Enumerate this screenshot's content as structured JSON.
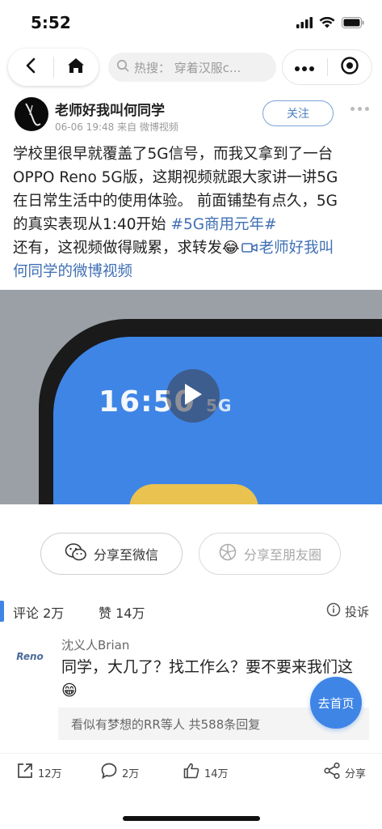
{
  "status_bar": {
    "time": "5:52",
    "icons": [
      "cellular-signal-icon",
      "wifi-icon",
      "battery-icon"
    ]
  },
  "nav": {
    "back_icon": "back-arrow-icon",
    "home_icon": "home-icon",
    "search_icon": "search-icon",
    "search_placeholder": "热搜：  穿着汉服c...",
    "more_icon": "more-dots-icon",
    "close_icon": "target-circle-icon"
  },
  "post": {
    "author": "老师好我叫何同学",
    "meta": "06-06 19:48 来自 微博视频",
    "follow_label": "关注",
    "text_lines": [
      "学校里很早就覆盖了5G信号，而我又拿到了一台",
      "OPPO Reno 5G版，这期视频就跟大家讲一讲5G",
      "在日常生活中的使用体验。 前面铺垫有点久，5G"
    ],
    "text_line4_prefix": "的真实表现从1:40开始 ",
    "hashtag": "#5G商用元年#",
    "text_line5_prefix": "还有，这视频做得贼累，求转发",
    "emoji": "😂",
    "video_link_part1": "老师好我叫",
    "video_link_part2": "何同学的微博视频"
  },
  "video": {
    "screen_time": "16:50",
    "screen_signal": "5G"
  },
  "share": {
    "wechat_label": "分享至微信",
    "moments_label": "分享至朋友圈"
  },
  "comments_header": {
    "comments_label": "评论 2万",
    "likes_label": "赞 14万",
    "report_label": "投诉"
  },
  "comment": {
    "avatar_text": "Reno",
    "name": "沈义人Brian",
    "text": "同学，大几了？找工作么？要不要来我们这",
    "emoji": "😁",
    "replies": "看似有梦想的RR等人 共588条回复"
  },
  "goto_home_label": "去首页",
  "bottom_bar": {
    "repost_count": "12万",
    "comment_count": "2万",
    "like_count": "14万",
    "share_label": "分享"
  },
  "colors": {
    "accent": "#3f85e6",
    "link": "#3f6fb4",
    "follow": "#4a7fc1"
  }
}
